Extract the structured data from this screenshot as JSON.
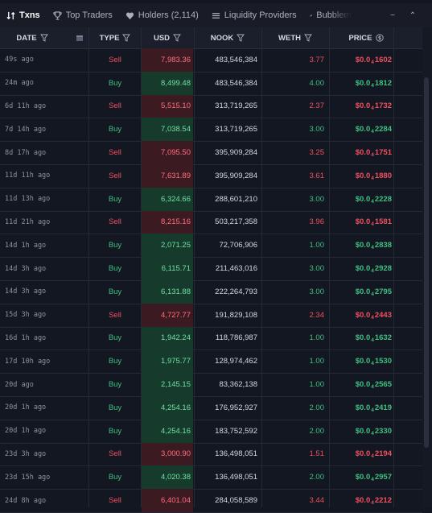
{
  "tabs": [
    {
      "label": "Txns",
      "icon": "swap-icon"
    },
    {
      "label": "Top Traders",
      "icon": "trophy-icon"
    },
    {
      "label": "Holders (2,114)",
      "icon": "heart-icon"
    },
    {
      "label": "Liquidity Providers",
      "icon": "list-icon"
    },
    {
      "label": "Bubblem",
      "icon": "bubbles-icon"
    }
  ],
  "window_controls": {
    "minimize": "−",
    "collapse": "⌃"
  },
  "columns": [
    "DATE",
    "TYPE",
    "USD",
    "NOOK",
    "WETH",
    "PRICE"
  ],
  "colors": {
    "buy": "#3fbf7f",
    "sell": "#ef4f5f"
  },
  "rows": [
    {
      "date": "49s ago",
      "type": "Sell",
      "usd": "7,983.36",
      "nook": "483,546,384",
      "weth": "3.77",
      "price_prefix": "$0.0",
      "price_sub": "4",
      "price_digits": "1602"
    },
    {
      "date": "24m ago",
      "type": "Buy",
      "usd": "8,499.48",
      "nook": "483,546,384",
      "weth": "4.00",
      "price_prefix": "$0.0",
      "price_sub": "4",
      "price_digits": "1812"
    },
    {
      "date": "6d 11h ago",
      "type": "Sell",
      "usd": "5,515.10",
      "nook": "313,719,265",
      "weth": "2.37",
      "price_prefix": "$0.0",
      "price_sub": "4",
      "price_digits": "1732"
    },
    {
      "date": "7d 14h ago",
      "type": "Buy",
      "usd": "7,038.54",
      "nook": "313,719,265",
      "weth": "3.00",
      "price_prefix": "$0.0",
      "price_sub": "4",
      "price_digits": "2284"
    },
    {
      "date": "8d 17h ago",
      "type": "Sell",
      "usd": "7,095.50",
      "nook": "395,909,284",
      "weth": "3.25",
      "price_prefix": "$0.0",
      "price_sub": "4",
      "price_digits": "1751"
    },
    {
      "date": "11d 11h ago",
      "type": "Sell",
      "usd": "7,631.89",
      "nook": "395,909,284",
      "weth": "3.61",
      "price_prefix": "$0.0",
      "price_sub": "4",
      "price_digits": "1880"
    },
    {
      "date": "11d 13h ago",
      "type": "Buy",
      "usd": "6,324.66",
      "nook": "288,601,210",
      "weth": "3.00",
      "price_prefix": "$0.0",
      "price_sub": "4",
      "price_digits": "2228"
    },
    {
      "date": "11d 21h ago",
      "type": "Sell",
      "usd": "8,215.16",
      "nook": "503,217,358",
      "weth": "3.96",
      "price_prefix": "$0.0",
      "price_sub": "4",
      "price_digits": "1581"
    },
    {
      "date": "14d 1h ago",
      "type": "Buy",
      "usd": "2,071.25",
      "nook": "72,706,906",
      "weth": "1.00",
      "price_prefix": "$0.0",
      "price_sub": "4",
      "price_digits": "2838"
    },
    {
      "date": "14d 3h ago",
      "type": "Buy",
      "usd": "6,115.71",
      "nook": "211,463,016",
      "weth": "3.00",
      "price_prefix": "$0.0",
      "price_sub": "4",
      "price_digits": "2928"
    },
    {
      "date": "14d 3h ago",
      "type": "Buy",
      "usd": "6,131.88",
      "nook": "222,264,793",
      "weth": "3.00",
      "price_prefix": "$0.0",
      "price_sub": "4",
      "price_digits": "2795"
    },
    {
      "date": "15d 3h ago",
      "type": "Sell",
      "usd": "4,727.77",
      "nook": "191,829,108",
      "weth": "2.34",
      "price_prefix": "$0.0",
      "price_sub": "4",
      "price_digits": "2443"
    },
    {
      "date": "16d 1h ago",
      "type": "Buy",
      "usd": "1,942.24",
      "nook": "118,786,987",
      "weth": "1.00",
      "price_prefix": "$0.0",
      "price_sub": "4",
      "price_digits": "1632"
    },
    {
      "date": "17d 10h ago",
      "type": "Buy",
      "usd": "1,975.77",
      "nook": "128,974,462",
      "weth": "1.00",
      "price_prefix": "$0.0",
      "price_sub": "4",
      "price_digits": "1530"
    },
    {
      "date": "20d ago",
      "type": "Buy",
      "usd": "2,145.15",
      "nook": "83,362,138",
      "weth": "1.00",
      "price_prefix": "$0.0",
      "price_sub": "4",
      "price_digits": "2565"
    },
    {
      "date": "20d 1h ago",
      "type": "Buy",
      "usd": "4,254.16",
      "nook": "176,952,927",
      "weth": "2.00",
      "price_prefix": "$0.0",
      "price_sub": "4",
      "price_digits": "2419"
    },
    {
      "date": "20d 1h ago",
      "type": "Buy",
      "usd": "4,254.16",
      "nook": "183,752,592",
      "weth": "2.00",
      "price_prefix": "$0.0",
      "price_sub": "4",
      "price_digits": "2330"
    },
    {
      "date": "23d 3h ago",
      "type": "Sell",
      "usd": "3,000.90",
      "nook": "136,498,051",
      "weth": "1.51",
      "price_prefix": "$0.0",
      "price_sub": "4",
      "price_digits": "2194"
    },
    {
      "date": "23d 15h ago",
      "type": "Buy",
      "usd": "4,020.38",
      "nook": "136,498,051",
      "weth": "2.00",
      "price_prefix": "$0.0",
      "price_sub": "4",
      "price_digits": "2957"
    },
    {
      "date": "24d 8h ago",
      "type": "Sell",
      "usd": "6,401.04",
      "nook": "284,058,589",
      "weth": "3.44",
      "price_prefix": "$0.0",
      "price_sub": "4",
      "price_digits": "2212"
    }
  ]
}
